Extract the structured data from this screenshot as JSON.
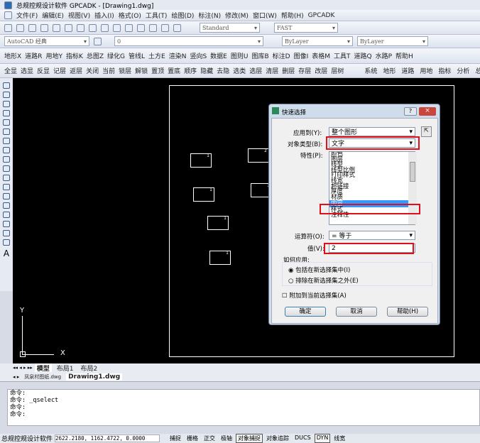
{
  "window": {
    "title": "总规控规设计软件 GPCADK - [Drawing1.dwg]"
  },
  "menu": [
    "文件(F)",
    "编辑(E)",
    "视图(V)",
    "插入(I)",
    "格式(O)",
    "工具(T)",
    "绘图(D)",
    "标注(N)",
    "修改(M)",
    "窗口(W)",
    "帮助(H)",
    "GPCADK"
  ],
  "toolbar": {
    "text_style": "Standard",
    "dim_style": "FAST",
    "workspace": "AutoCAD 经典",
    "layer": "0",
    "color": "ByLayer",
    "linetype": "ByLayer"
  },
  "gp_menu": [
    "地形X",
    "道路R",
    "用地Y",
    "指标K",
    "总图Z",
    "绿化G",
    "管线L",
    "土方E",
    "渲染N",
    "竖向S",
    "数据E",
    "图则U",
    "图库B",
    "标注D",
    "图像I",
    "表格M",
    "工具T",
    "道路Q",
    "水路P",
    "帮助H"
  ],
  "layer_tools": [
    "全显",
    "选显",
    "反显",
    "记层",
    "返层",
    "关闭",
    "当前",
    "锁层",
    "解锁",
    "置顶",
    "置底",
    "顺序",
    "隐藏",
    "去隐",
    "选类",
    "选层",
    "清层",
    "删层",
    "存层",
    "改层",
    "层树"
  ],
  "right_tools": [
    "系统",
    "地形",
    "道路",
    "用地",
    "指标",
    "分析",
    "总平"
  ],
  "drawing": {
    "labels": [
      "1",
      "2",
      "1",
      "1",
      "1",
      "1"
    ],
    "ucs_x": "X",
    "ucs_y": "Y"
  },
  "layout_tabs": [
    "模型",
    "布局1",
    "布局2"
  ],
  "file_tabs": [
    "凤泉村图纸.dwg",
    "Drawing1.dwg"
  ],
  "command_lines": [
    "命令:",
    "命令: _qselect",
    "命令:",
    "命令:"
  ],
  "status": {
    "app": "总规控规设计软件",
    "coords": "2622.2180, 1162.4722, 0.0000",
    "toggles": [
      "捕捉",
      "栅格",
      "正交",
      "极轴",
      "对象捕捉",
      "对象追踪",
      "DUCS",
      "DYN",
      "线宽"
    ]
  },
  "dialog": {
    "title": "快速选择",
    "apply_to_label": "应用到(Y):",
    "apply_to": "整个图形",
    "object_type_label": "对象类型(B):",
    "object_type": "文字",
    "properties_label": "特性(P):",
    "properties": [
      "颜色",
      "图层",
      "线型",
      "线型比例",
      "打印样式",
      "线宽",
      "超链接",
      "厚度",
      "材质",
      "内容",
      "样式",
      "注释性"
    ],
    "selected_index": 9,
    "operator_label": "运算符(O):",
    "operator": "= 等于",
    "value_label": "值(V):",
    "value": "2",
    "how_apply_label": "如何应用:",
    "radio_include": "包括在新选择集中(I)",
    "radio_exclude": "排除在新选择集之外(E)",
    "append_label": "附加到当前选择集(A)",
    "ok": "确定",
    "cancel": "取消",
    "help": "帮助(H)",
    "help_icon": "?",
    "close_icon": "×"
  },
  "colors": {
    "highlight": "#e0101a",
    "selection": "#3399ff"
  }
}
